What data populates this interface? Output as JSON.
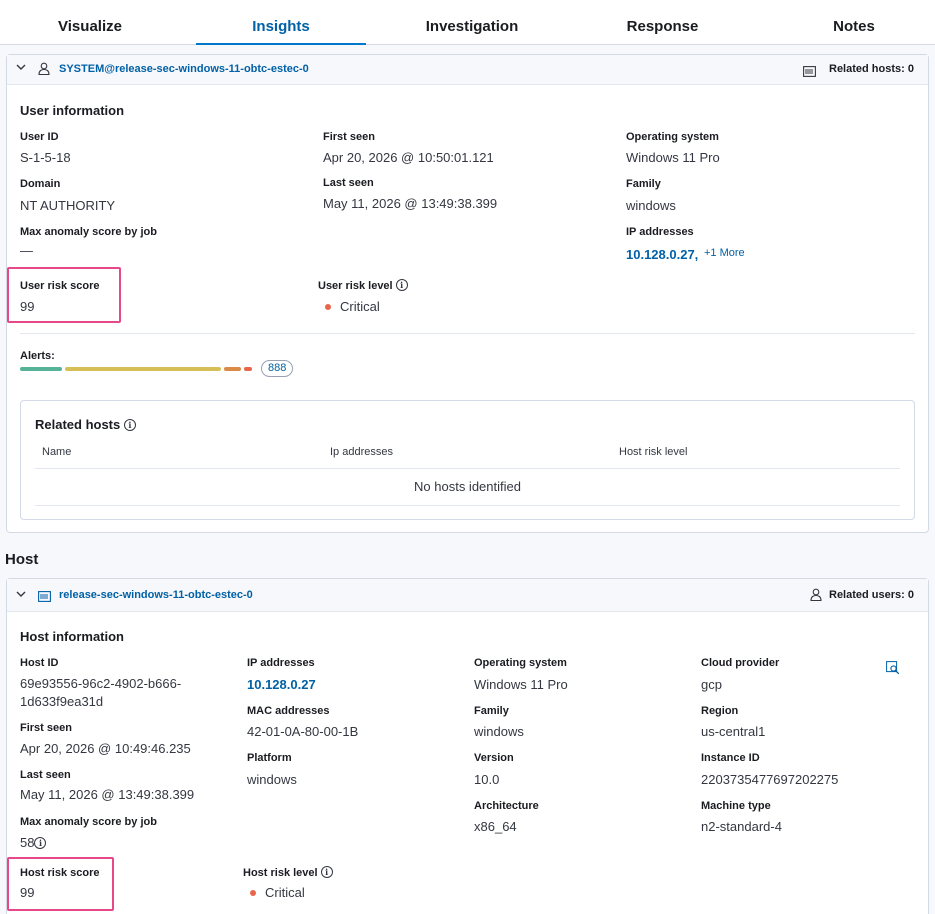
{
  "tabs": [
    "Visualize",
    "Insights",
    "Investigation",
    "Response",
    "Notes"
  ],
  "user_panel": {
    "header_link": "SYSTEM@release-sec-windows-11-obtc-estec-0",
    "related_hosts": "Related hosts: 0",
    "title": "User information",
    "user_id_label": "User ID",
    "user_id": "S-1-5-18",
    "first_seen_label": "First seen",
    "first_seen": "Apr 20, 2026 @ 10:50:01.121",
    "os_label": "Operating system",
    "os": "Windows 11 Pro",
    "domain_label": "Domain",
    "domain": "NT AUTHORITY",
    "last_seen_label": "Last seen",
    "last_seen": "May 11, 2026 @ 13:49:38.399",
    "family_label": "Family",
    "family": "windows",
    "max_anomaly_label": "Max anomaly score by job",
    "max_anomaly": "—",
    "ip_label": "IP addresses",
    "ip": "10.128.0.27,",
    "ip_more": "+1 More",
    "risk_score_label": "User risk score",
    "risk_score": "99",
    "risk_level_label": "User risk level",
    "risk_level": "Critical",
    "alerts_label": "Alerts:",
    "alerts_count": "888",
    "alerts_segments": [
      {
        "color": "#54b399",
        "fraction": 0.19
      },
      {
        "color": "#d6bf57",
        "fraction": 0.7
      },
      {
        "color": "#da8b45",
        "fraction": 0.075
      },
      {
        "color": "#e7664c",
        "fraction": 0.035
      }
    ],
    "related_hosts_title": "Related hosts",
    "columns": [
      "Name",
      "Ip addresses",
      "Host risk level"
    ],
    "empty": "No hosts identified"
  },
  "host_section_title": "Host",
  "host_panel": {
    "header_link": "release-sec-windows-11-obtc-estec-0",
    "related_users": "Related users: 0",
    "title": "Host information",
    "host_id_label": "Host ID",
    "host_id_1": "69e93556-96c2-4902-b666-",
    "host_id_2": "1d633f9ea31d",
    "ip_label": "IP addresses",
    "ip": "10.128.0.27",
    "os_label": "Operating system",
    "os": "Windows 11 Pro",
    "cloud_label": "Cloud provider",
    "cloud": "gcp",
    "first_seen_label": "First seen",
    "first_seen": "Apr 20, 2026 @ 10:49:46.235",
    "mac_label": "MAC addresses",
    "mac": "42-01-0A-80-00-1B",
    "family_label": "Family",
    "family": "windows",
    "region_label": "Region",
    "region": "us-central1",
    "last_seen_label": "Last seen",
    "last_seen": "May 11, 2026 @ 13:49:38.399",
    "platform_label": "Platform",
    "platform": "windows",
    "version_label": "Version",
    "version": "10.0",
    "instance_label": "Instance ID",
    "instance": "2203735477697202275",
    "max_anomaly_label": "Max anomaly score by job",
    "max_anomaly": "58",
    "arch_label": "Architecture",
    "arch": "x86_64",
    "machine_label": "Machine type",
    "machine": "n2-standard-4",
    "risk_score_label": "Host risk score",
    "risk_score": "99",
    "risk_level_label": "Host risk level",
    "risk_level": "Critical"
  },
  "icons": {
    "user": "user-icon",
    "host": "host-icon",
    "info": "info-icon",
    "inspect": "inspect-icon",
    "chevron": "chevron-down-icon"
  }
}
